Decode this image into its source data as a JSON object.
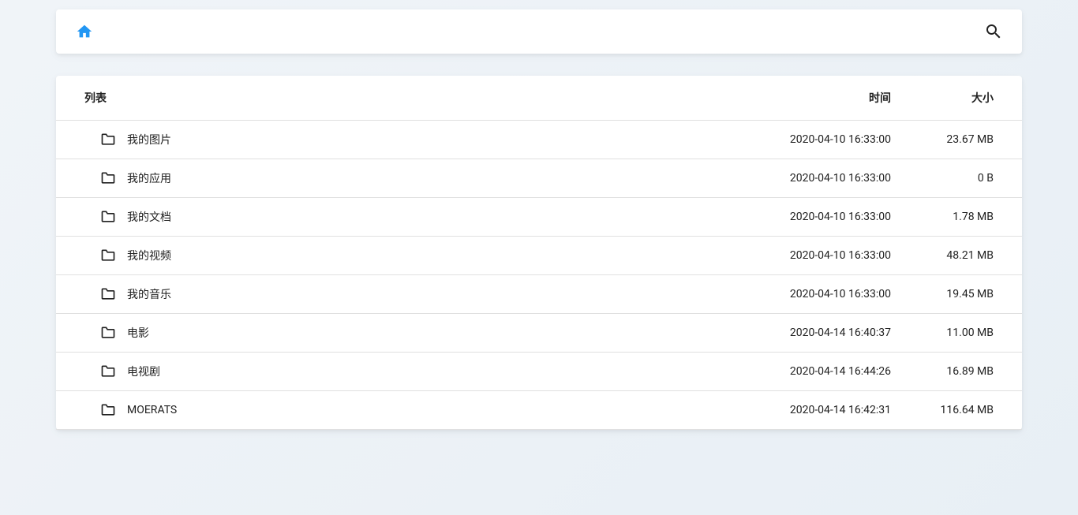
{
  "columns": {
    "name": "列表",
    "time": "时间",
    "size": "大小"
  },
  "rows": [
    {
      "name": "我的图片",
      "time": "2020-04-10 16:33:00",
      "size": "23.67 MB"
    },
    {
      "name": "我的应用",
      "time": "2020-04-10 16:33:00",
      "size": "0 B"
    },
    {
      "name": "我的文档",
      "time": "2020-04-10 16:33:00",
      "size": "1.78 MB"
    },
    {
      "name": "我的视频",
      "time": "2020-04-10 16:33:00",
      "size": "48.21 MB"
    },
    {
      "name": "我的音乐",
      "time": "2020-04-10 16:33:00",
      "size": "19.45 MB"
    },
    {
      "name": "电影",
      "time": "2020-04-14 16:40:37",
      "size": "11.00 MB"
    },
    {
      "name": "电视剧",
      "time": "2020-04-14 16:44:26",
      "size": "16.89 MB"
    },
    {
      "name": "MOERATS",
      "time": "2020-04-14 16:42:31",
      "size": "116.64 MB"
    }
  ]
}
